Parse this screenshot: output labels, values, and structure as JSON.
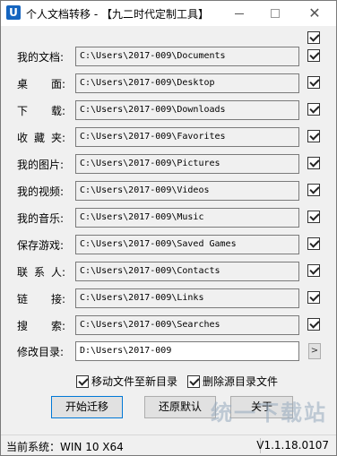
{
  "window": {
    "title": "个人文档转移 - 【九二时代定制工具】",
    "app_icon_letter": "U",
    "close_glyph": "✕"
  },
  "folders": [
    {
      "label": "我的文档:",
      "path": "C:\\Users\\2017-009\\Documents",
      "checked": true
    },
    {
      "label": "桌    面:",
      "chars": [
        "桌",
        "面:"
      ],
      "path": "C:\\Users\\2017-009\\Desktop",
      "checked": true
    },
    {
      "label": "下    载:",
      "chars": [
        "下",
        "载:"
      ],
      "path": "C:\\Users\\2017-009\\Downloads",
      "checked": true
    },
    {
      "label": "收 藏 夹:",
      "chars": [
        "收",
        "藏",
        "夹:"
      ],
      "path": "C:\\Users\\2017-009\\Favorites",
      "checked": true
    },
    {
      "label": "我的图片:",
      "path": "C:\\Users\\2017-009\\Pictures",
      "checked": true
    },
    {
      "label": "我的视频:",
      "path": "C:\\Users\\2017-009\\Videos",
      "checked": true
    },
    {
      "label": "我的音乐:",
      "path": "C:\\Users\\2017-009\\Music",
      "checked": true
    },
    {
      "label": "保存游戏:",
      "path": "C:\\Users\\2017-009\\Saved Games",
      "checked": true
    },
    {
      "label": "联 系 人:",
      "chars": [
        "联",
        "系",
        "人:"
      ],
      "path": "C:\\Users\\2017-009\\Contacts",
      "checked": true
    },
    {
      "label": "链    接:",
      "chars": [
        "链",
        "接:"
      ],
      "path": "C:\\Users\\2017-009\\Links",
      "checked": true
    },
    {
      "label": "搜    索:",
      "chars": [
        "搜",
        "索:"
      ],
      "path": "C:\\Users\\2017-009\\Searches",
      "checked": true
    }
  ],
  "target": {
    "label": "修改目录:",
    "path": "D:\\Users\\2017-009",
    "browse_glyph": ">"
  },
  "options": {
    "move_files_label": "移动文件至新目录",
    "delete_source_label": "删除源目录文件"
  },
  "buttons": {
    "start": "开始迁移",
    "restore": "还原默认",
    "about": "关于"
  },
  "watermark": "统一下载站",
  "status": {
    "system": "当前系统：WIN 10 X64",
    "version": "V1.1.18.0107"
  }
}
